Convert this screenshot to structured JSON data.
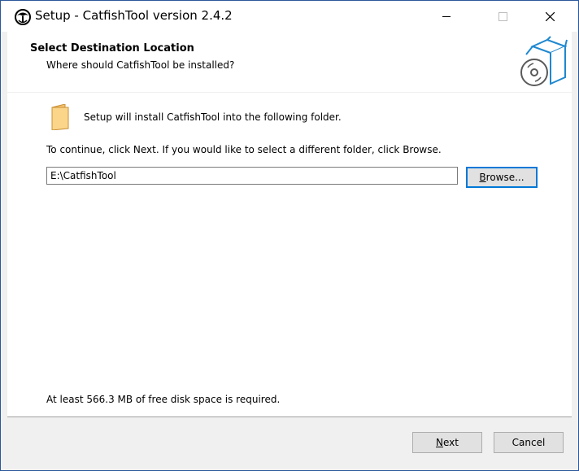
{
  "window": {
    "title": "Setup - CatfishTool version 2.4.2",
    "accent_color": "#2b579a"
  },
  "header": {
    "title": "Select Destination Location",
    "subtitle": "Where should CatfishTool be installed?",
    "icon": "install-box-disc-icon"
  },
  "content": {
    "folder_icon": "folder-icon",
    "install_message": "Setup will install CatfishTool into the following folder.",
    "continue_message": "To continue, click Next. If you would like to select a different folder, click Browse.",
    "install_path": "E:\\CatfishTool",
    "browse": {
      "accel": "B",
      "rest": "rowse..."
    },
    "disk_space_message": "At least 566.3 MB of free disk space is required."
  },
  "footer": {
    "next": {
      "accel": "N",
      "rest": "ext"
    },
    "cancel_label": "Cancel"
  }
}
